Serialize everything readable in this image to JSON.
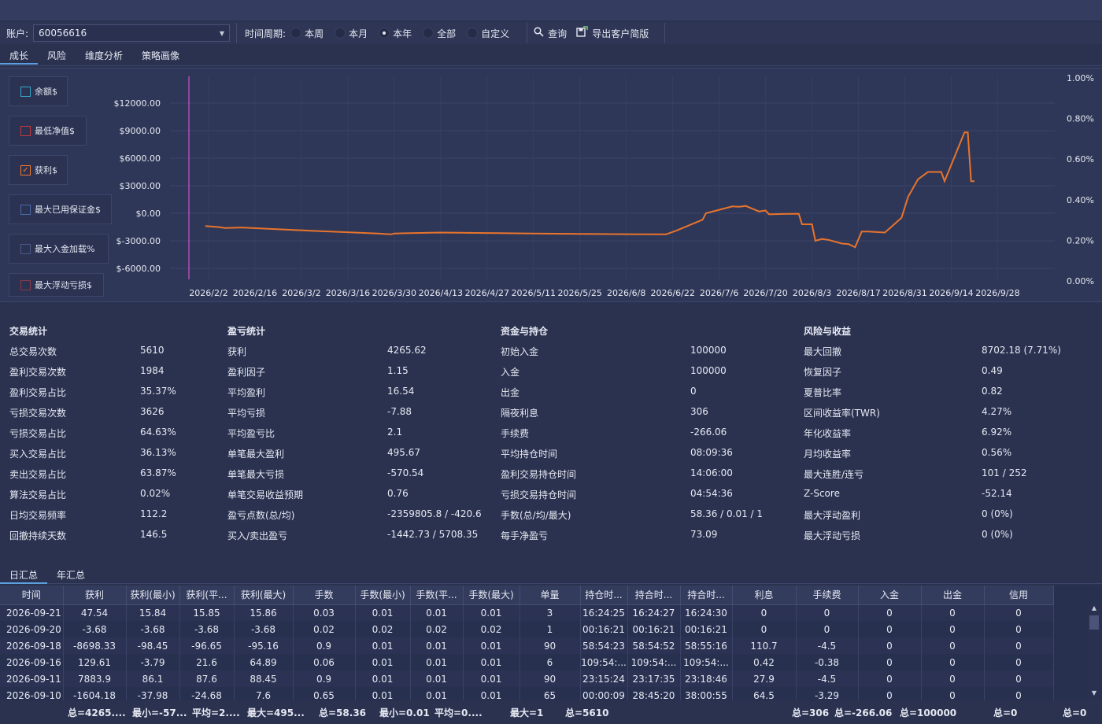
{
  "toolbar": {
    "account_label": "账户:",
    "account_value": "60056616",
    "period_label": "时间周期:",
    "periods": [
      "本周",
      "本月",
      "本年",
      "全部",
      "自定义"
    ],
    "selected_period": "本年",
    "query_label": "查询",
    "export_label": "导出客户简版"
  },
  "tabs": [
    "成长",
    "风险",
    "维度分析",
    "策略画像"
  ],
  "active_tab": "成长",
  "legend": [
    {
      "label": "余额$",
      "checked": false,
      "color": "#3aa8c8"
    },
    {
      "label": "最低净值$",
      "checked": false,
      "color": "#c83a3a"
    },
    {
      "label": "获利$",
      "checked": true,
      "color": "#f07a30"
    },
    {
      "label": "最大已用保证金$",
      "checked": false,
      "color": "#4a6aa8"
    },
    {
      "label": "最大入金加载%",
      "checked": false,
      "color": "#4a5a88"
    },
    {
      "label": "最大浮动亏损$",
      "checked": false,
      "color": "#8a3a4a"
    }
  ],
  "chart_data": {
    "type": "line",
    "title": "",
    "y_left_ticks": [
      "$12000.00",
      "$9000.00",
      "$6000.00",
      "$3000.00",
      "$0.00",
      "$-3000.00",
      "$-6000.00"
    ],
    "y_right_ticks": [
      "1.00%",
      "0.80%",
      "0.60%",
      "0.40%",
      "0.20%",
      "0.00%"
    ],
    "x_ticks": [
      "2026/2/2",
      "2026/2/16",
      "2026/3/2",
      "2026/3/16",
      "2026/3/30",
      "2026/4/13",
      "2026/4/27",
      "2026/5/11",
      "2026/5/25",
      "2026/6/8",
      "2026/6/22",
      "2026/7/6",
      "2026/7/20",
      "2026/8/3",
      "2026/8/17",
      "2026/8/31",
      "2026/9/14",
      "2026/9/28"
    ],
    "ylim": [
      -7000,
      14000
    ],
    "series": [
      {
        "name": "获利$",
        "color": "#e8742c",
        "x": [
          "2026-02-01",
          "2026-02-05",
          "2026-02-07",
          "2026-02-12",
          "2026-02-20",
          "2026-03-05",
          "2026-03-18",
          "2026-03-25",
          "2026-03-29",
          "2026-03-30",
          "2026-04-13",
          "2026-04-27",
          "2026-05-11",
          "2026-05-25",
          "2026-06-08",
          "2026-06-20",
          "2026-06-23",
          "2026-06-29",
          "2026-07-01",
          "2026-07-02",
          "2026-07-10",
          "2026-07-12",
          "2026-07-14",
          "2026-07-18",
          "2026-07-20",
          "2026-07-21",
          "2026-07-22",
          "2026-07-25",
          "2026-07-30",
          "2026-07-31",
          "2026-08-02",
          "2026-08-03",
          "2026-08-04",
          "2026-08-06",
          "2026-08-08",
          "2026-08-12",
          "2026-08-14",
          "2026-08-16",
          "2026-08-18",
          "2026-08-20",
          "2026-08-25",
          "2026-08-30",
          "2026-09-01",
          "2026-09-04",
          "2026-09-07",
          "2026-09-09",
          "2026-09-11",
          "2026-09-12",
          "2026-09-18",
          "2026-09-19",
          "2026-09-20",
          "2026-09-21"
        ],
        "y": [
          -1400,
          -1500,
          -1600,
          -1550,
          -1700,
          -1900,
          -2100,
          -2200,
          -2300,
          -2200,
          -2100,
          -2150,
          -2200,
          -2250,
          -2280,
          -2300,
          -1900,
          -1000,
          -700,
          0,
          750,
          700,
          800,
          200,
          300,
          -100,
          -100,
          -80,
          -50,
          -1200,
          -1200,
          -1200,
          -3000,
          -2800,
          -2900,
          -3300,
          -3350,
          -3700,
          -2000,
          -2000,
          -2100,
          -500,
          1800,
          3700,
          4500,
          4500,
          4500,
          3500,
          8800,
          8800,
          3500,
          3500
        ]
      }
    ]
  },
  "stats": {
    "columns": [
      {
        "title": "交易统计",
        "rows": [
          [
            "总交易次数",
            "5610"
          ],
          [
            "盈利交易次数",
            "1984"
          ],
          [
            "盈利交易占比",
            "35.37%"
          ],
          [
            "亏损交易次数",
            "3626"
          ],
          [
            "亏损交易占比",
            "64.63%"
          ],
          [
            "买入交易占比",
            "36.13%"
          ],
          [
            "卖出交易占比",
            "63.87%"
          ],
          [
            "算法交易占比",
            "0.02%"
          ],
          [
            "日均交易频率",
            "112.2"
          ],
          [
            "回撤持续天数",
            "146.5"
          ]
        ]
      },
      {
        "title": "盈亏统计",
        "rows": [
          [
            "获利",
            "4265.62"
          ],
          [
            "盈利因子",
            "1.15"
          ],
          [
            "平均盈利",
            "16.54"
          ],
          [
            "平均亏损",
            "-7.88"
          ],
          [
            "平均盈亏比",
            "2.1"
          ],
          [
            "单笔最大盈利",
            "495.67"
          ],
          [
            "单笔最大亏损",
            "-570.54"
          ],
          [
            "单笔交易收益预期",
            "0.76"
          ],
          [
            "盈亏点数(总/均)",
            "-2359805.8 / -420.6"
          ],
          [
            "买入/卖出盈亏",
            "-1442.73 / 5708.35"
          ]
        ]
      },
      {
        "title": "资金与持仓",
        "rows": [
          [
            "初始入金",
            "100000"
          ],
          [
            "入金",
            "100000"
          ],
          [
            "出金",
            "0"
          ],
          [
            "隔夜利息",
            "306"
          ],
          [
            "手续费",
            "-266.06"
          ],
          [
            "平均持仓时间",
            "08:09:36"
          ],
          [
            "盈利交易持仓时间",
            "14:06:00"
          ],
          [
            "亏损交易持仓时间",
            "04:54:36"
          ],
          [
            "手数(总/均/最大)",
            "58.36 / 0.01 / 1"
          ],
          [
            "每手净盈亏",
            "73.09"
          ]
        ]
      },
      {
        "title": "风险与收益",
        "rows": [
          [
            "最大回撤",
            "8702.18 (7.71%)"
          ],
          [
            "恢复因子",
            "0.49"
          ],
          [
            "夏普比率",
            "0.82"
          ],
          [
            "区间收益率(TWR)",
            "4.27%"
          ],
          [
            "年化收益率",
            "6.92%"
          ],
          [
            "月均收益率",
            "0.56%"
          ],
          [
            "最大连胜/连亏",
            "101 / 252"
          ],
          [
            "Z-Score",
            "-52.14"
          ],
          [
            "最大浮动盈利",
            "0 (0%)"
          ],
          [
            "最大浮动亏损",
            "0 (0%)"
          ]
        ]
      }
    ]
  },
  "bottom_tabs": [
    "日汇总",
    "年汇总"
  ],
  "bottom_active_tab": "日汇总",
  "table": {
    "headers": [
      "时间",
      "获利",
      "获利(最小)",
      "获利(平...",
      "获利(最大)",
      "手数",
      "手数(最小)",
      "手数(平...",
      "手数(最大)",
      "单量",
      "持仓时...",
      "持合时...",
      "持合时...",
      "利息",
      "手续费",
      "入金",
      "出金",
      "信用"
    ],
    "rows": [
      [
        "2026-09-21",
        "47.54",
        "15.84",
        "15.85",
        "15.86",
        "0.03",
        "0.01",
        "0.01",
        "0.01",
        "3",
        "16:24:25",
        "16:24:27",
        "16:24:30",
        "0",
        "0",
        "0",
        "0",
        "0"
      ],
      [
        "2026-09-20",
        "-3.68",
        "-3.68",
        "-3.68",
        "-3.68",
        "0.02",
        "0.02",
        "0.02",
        "0.02",
        "1",
        "00:16:21",
        "00:16:21",
        "00:16:21",
        "0",
        "0",
        "0",
        "0",
        "0"
      ],
      [
        "2026-09-18",
        "-8698.33",
        "-98.45",
        "-96.65",
        "-95.16",
        "0.9",
        "0.01",
        "0.01",
        "0.01",
        "90",
        "58:54:23",
        "58:54:52",
        "58:55:16",
        "110.7",
        "-4.5",
        "0",
        "0",
        "0"
      ],
      [
        "2026-09-16",
        "129.61",
        "-3.79",
        "21.6",
        "64.89",
        "0.06",
        "0.01",
        "0.01",
        "0.01",
        "6",
        "109:54:...",
        "109:54:...",
        "109:54:...",
        "0.42",
        "-0.38",
        "0",
        "0",
        "0"
      ],
      [
        "2026-09-11",
        "7883.9",
        "86.1",
        "87.6",
        "88.45",
        "0.9",
        "0.01",
        "0.01",
        "0.01",
        "90",
        "23:15:24",
        "23:17:35",
        "23:18:46",
        "27.9",
        "-4.5",
        "0",
        "0",
        "0"
      ],
      [
        "2026-09-10",
        "-1604.18",
        "-37.98",
        "-24.68",
        "7.6",
        "0.65",
        "0.01",
        "0.01",
        "0.01",
        "65",
        "00:00:09",
        "28:45:20",
        "38:00:55",
        "64.5",
        "-3.29",
        "0",
        "0",
        "0"
      ]
    ],
    "footer": [
      "总=4265....",
      "最小=-57...",
      "平均=2....",
      "最大=495...",
      "总=58.36",
      "最小=0.01",
      "平均=0....",
      "最大=1",
      "总=5610",
      "总=306",
      "总=-266.06",
      "总=100000",
      "总=0",
      "总=0"
    ]
  }
}
